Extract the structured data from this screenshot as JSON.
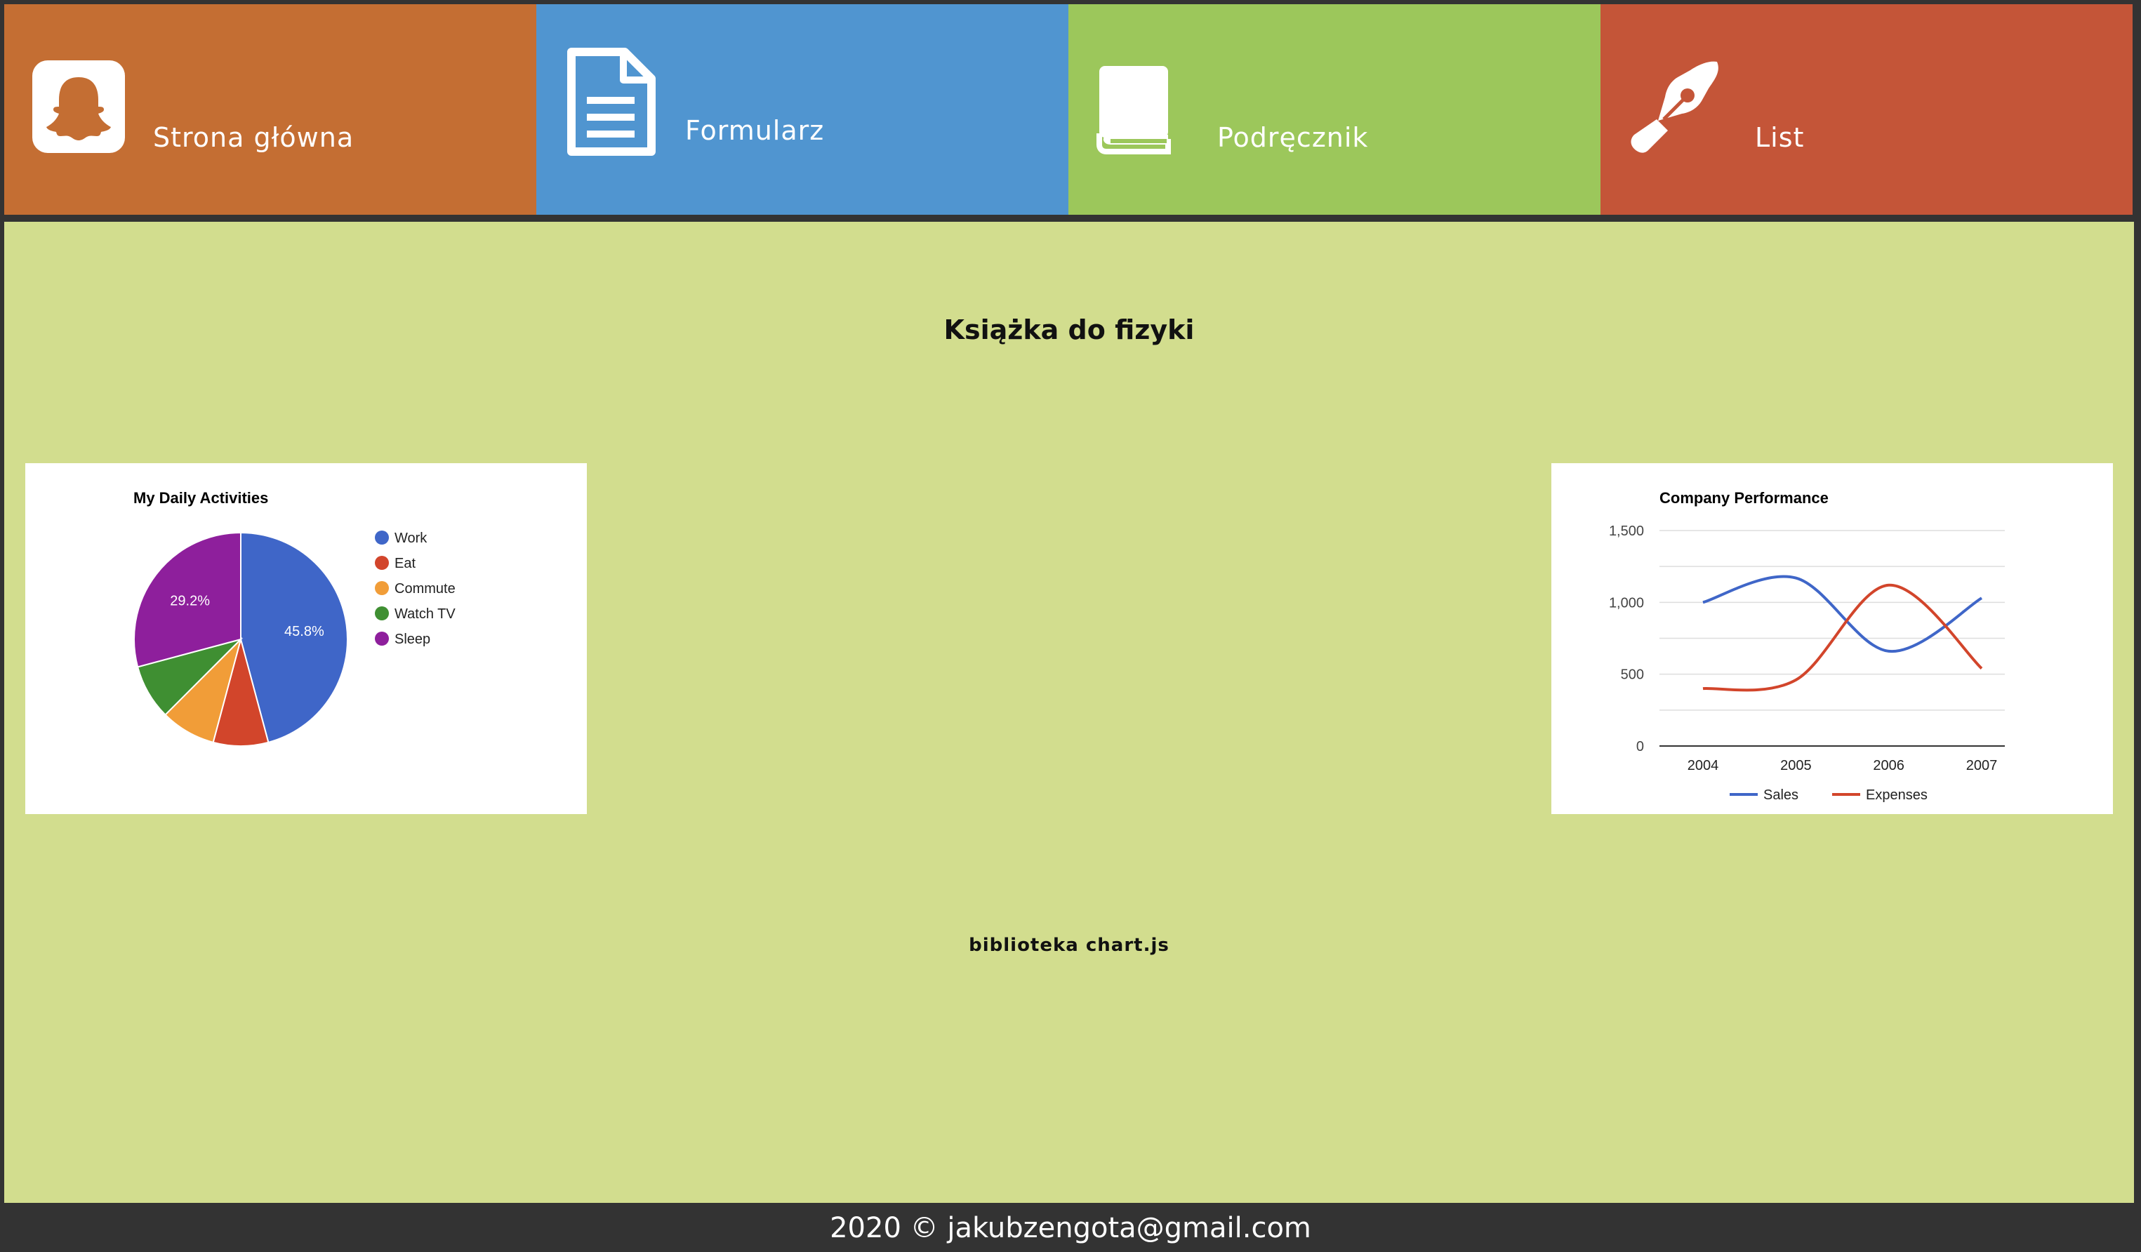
{
  "colors": {
    "tile_home": "#c46e33",
    "tile_form": "#5095d0",
    "tile_handbook": "#9cc75b",
    "tile_letter": "#c45538",
    "content_bg": "#d2dd8e",
    "frame": "#333333"
  },
  "nav": {
    "items": [
      {
        "label": "Strona główna",
        "icon": "snapchat-ghost-icon"
      },
      {
        "label": "Formularz",
        "icon": "document-icon"
      },
      {
        "label": "Podręcznik",
        "icon": "book-icon"
      },
      {
        "label": "List",
        "icon": "pen-nib-icon"
      }
    ]
  },
  "main": {
    "title": "Książka do fizyki",
    "caption": "biblioteka chart.js"
  },
  "footer": {
    "text": "2020 © jakubzengota@gmail.com"
  },
  "chart_data": [
    {
      "type": "pie",
      "title": "My Daily Activities",
      "categories": [
        "Work",
        "Eat",
        "Commute",
        "Watch TV",
        "Sleep"
      ],
      "values": [
        11,
        2,
        2,
        2,
        7
      ],
      "colors": [
        "#3f66c8",
        "#d2452b",
        "#f19d38",
        "#3f8f32",
        "#8e1f9c"
      ],
      "data_labels": [
        "45.8%",
        "",
        "",
        "",
        "29.2%"
      ],
      "legend": "right"
    },
    {
      "type": "line",
      "title": "Company Performance",
      "x": [
        "2004",
        "2005",
        "2006",
        "2007"
      ],
      "series": [
        {
          "name": "Sales",
          "values": [
            1000,
            1170,
            660,
            1030
          ],
          "color": "#3f66c8"
        },
        {
          "name": "Expenses",
          "values": [
            400,
            460,
            1120,
            540
          ],
          "color": "#d2452b"
        }
      ],
      "ylim": [
        0,
        1500
      ],
      "yticks": [
        "0",
        "500",
        "1,000",
        "1,500"
      ],
      "grid": true,
      "legend": "bottom"
    }
  ]
}
